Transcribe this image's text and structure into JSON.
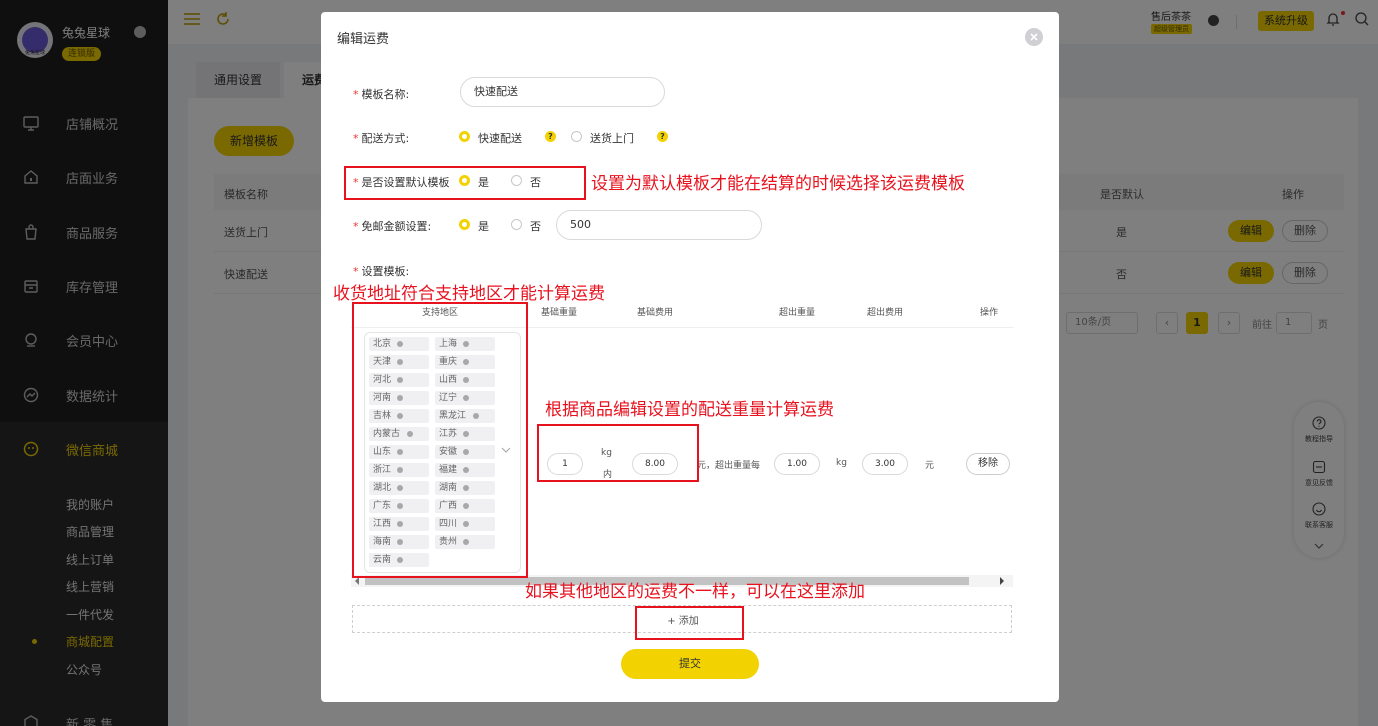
{
  "sidebar": {
    "store_name": "兔兔星球",
    "store_badge": "连锁版",
    "logo_text": "兔兔星球",
    "nav": [
      {
        "label": "店铺概况",
        "icon": "monitor-icon"
      },
      {
        "label": "店面业务",
        "icon": "home-icon"
      },
      {
        "label": "商品服务",
        "icon": "bag-icon"
      },
      {
        "label": "库存管理",
        "icon": "box-icon"
      },
      {
        "label": "会员中心",
        "icon": "member-icon"
      },
      {
        "label": "数据统计",
        "icon": "chart-icon"
      },
      {
        "label": "微信商城",
        "icon": "wechat-icon"
      },
      {
        "label": "新 零 售",
        "icon": "cube-icon"
      }
    ],
    "sub_items": [
      "我的账户",
      "商品管理",
      "线上订单",
      "线上营销",
      "一件代发",
      "商城配置",
      "公众号"
    ],
    "current_sub": "商城配置"
  },
  "topbar": {
    "user_name": "售后茶茶",
    "user_role": "超级管理员",
    "upgrade_label": "系统升级"
  },
  "background": {
    "tabs": [
      "通用设置",
      "运费"
    ],
    "add_template_label": "新增模板",
    "columns": [
      "模板名称",
      "是否默认",
      "操作"
    ],
    "rows": [
      {
        "name": "送货上门",
        "default": "是"
      },
      {
        "name": "快速配送",
        "default": "否"
      }
    ],
    "edit_label": "编辑",
    "delete_label": "删除",
    "pager": {
      "page_size": "10条/页",
      "current_page": "1",
      "goto_label": "前往",
      "goto_value": "1",
      "page_suffix": "页"
    },
    "float_panel": [
      "教程指导",
      "意见反馈",
      "联系客服"
    ]
  },
  "modal": {
    "title": "编辑运费",
    "template_name_label": "模板名称:",
    "template_name_value": "快速配送",
    "delivery_label": "配送方式:",
    "delivery_options": [
      "快速配送",
      "送货上门"
    ],
    "default_label": "是否设置默认模板",
    "free_label": "免邮金额设置:",
    "yes": "是",
    "no": "否",
    "free_amount": "500",
    "settings_label": "设置模板:",
    "table": {
      "headers": [
        "支持地区",
        "基础重量",
        "基础费用",
        "超出重量",
        "超出费用",
        "操作"
      ],
      "regions": [
        "北京",
        "上海",
        "天津",
        "重庆",
        "河北",
        "山西",
        "河南",
        "辽宁",
        "吉林",
        "黑龙江",
        "内蒙古",
        "江苏",
        "山东",
        "安徽",
        "浙江",
        "福建",
        "湖北",
        "湖南",
        "广东",
        "广西",
        "江西",
        "四川",
        "海南",
        "贵州",
        "云南"
      ],
      "base_weight": "1",
      "kg_within_1": "kg",
      "kg_within_2": "内",
      "base_fee": "8.00",
      "mid_text": "元，超出重量每",
      "extra_weight": "1.00",
      "kg_unit": "kg",
      "extra_fee": "3.00",
      "yuan_unit": "元",
      "remove_label": "移除"
    },
    "add_label": "+ 添加",
    "submit_label": "提交"
  },
  "annotations": {
    "default_tip": "设置为默认模板才能在结算的时候选择该运费模板",
    "region_tip": "收货地址符合支持地区才能计算运费",
    "weight_tip": "根据商品编辑设置的配送重量计算运费",
    "add_tip": "如果其他地区的运费不一样，可以在这里添加"
  },
  "colors": {
    "accent": "#f2d200",
    "sidebar_bg": "#1f1f21",
    "annotation_red": "#e8121f"
  }
}
